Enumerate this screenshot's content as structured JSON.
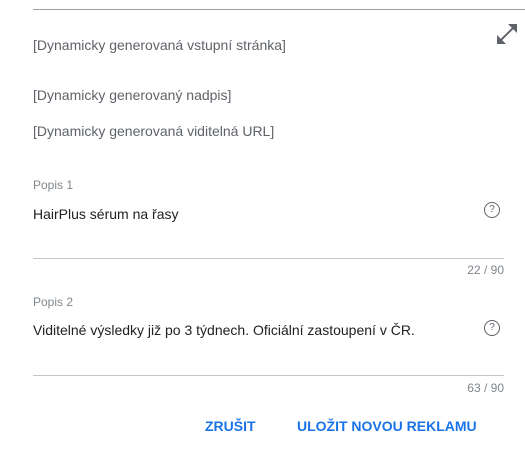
{
  "preview": {
    "landing_page": "[Dynamicky generovaná vstupní stránka]",
    "headline": "[Dynamicky generovaný nadpis]",
    "display_url": "[Dynamicky generovaná viditelná URL]"
  },
  "fields": [
    {
      "label": "Popis 1",
      "value": "HairPlus sérum na řasy",
      "counter": "22 / 90",
      "help_glyph": "?"
    },
    {
      "label": "Popis 2",
      "value": "Viditelné výsledky již po 3 týdnech. Oficiální zastoupení v ČR.",
      "counter": "63 / 90",
      "help_glyph": "?"
    }
  ],
  "actions": {
    "cancel_label": "ZRUŠIT",
    "save_label": "ULOŽIT NOVOU REKLAMU"
  },
  "icons": {
    "expand": "expand-icon",
    "help": "help-icon"
  },
  "colors": {
    "accent": "#1a73e8",
    "text_primary": "#202124",
    "text_secondary": "#5f6368",
    "divider": "#c4c7c5"
  }
}
